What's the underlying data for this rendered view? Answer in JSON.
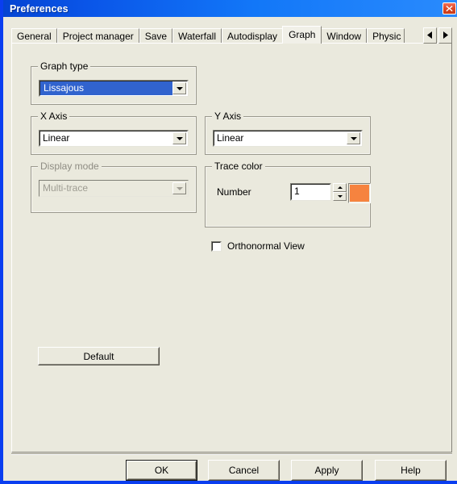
{
  "window": {
    "title": "Preferences",
    "close_icon": "close-icon"
  },
  "tabs": {
    "items": [
      {
        "label": "General",
        "selected": false
      },
      {
        "label": "Project manager",
        "selected": false
      },
      {
        "label": "Save",
        "selected": false
      },
      {
        "label": "Waterfall",
        "selected": false
      },
      {
        "label": "Autodisplay",
        "selected": false
      },
      {
        "label": "Graph",
        "selected": true
      },
      {
        "label": "Window",
        "selected": false
      },
      {
        "label": "Physic",
        "selected": false
      }
    ],
    "scroll_left_icon": "arrow-left-icon",
    "scroll_right_icon": "arrow-right-icon"
  },
  "graph_type": {
    "legend": "Graph type",
    "value": "Lissajous",
    "dropdown_icon": "chevron-down-icon"
  },
  "x_axis": {
    "legend": "X Axis",
    "value": "Linear",
    "dropdown_icon": "chevron-down-icon"
  },
  "y_axis": {
    "legend": "Y Axis",
    "value": "Linear",
    "dropdown_icon": "chevron-down-icon"
  },
  "display_mode": {
    "legend": "Display mode",
    "value": "Multi-trace",
    "disabled": true,
    "dropdown_icon": "chevron-down-icon"
  },
  "trace_color": {
    "legend": "Trace color",
    "number_label": "Number",
    "number_value": "1",
    "spinner_up_icon": "arrow-up-icon",
    "spinner_down_icon": "arrow-down-icon",
    "swatch_color": "#f6833f"
  },
  "orthonormal": {
    "label": "Orthonormal View",
    "checked": false
  },
  "default_button": {
    "label": "Default"
  },
  "footer": {
    "ok": "OK",
    "cancel": "Cancel",
    "apply": "Apply",
    "help": "Help"
  },
  "colors": {
    "titlebar_start": "#0444d2",
    "titlebar_end": "#2a8bfd",
    "dialog_face": "#eae9dd",
    "selection_blue": "#3163ce",
    "border_blue": "#0a3ef0",
    "trace_orange": "#f6833f"
  }
}
